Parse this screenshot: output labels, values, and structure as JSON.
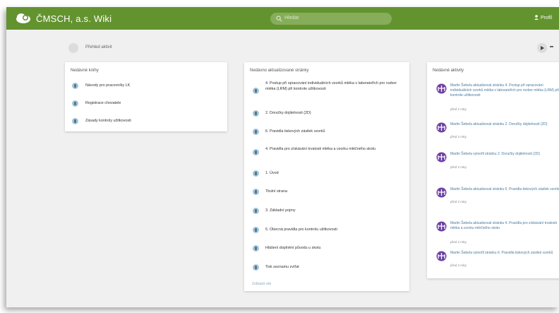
{
  "app": {
    "title": "ČMSCH, a.s. Wiki",
    "logo_icon": "cloud-logo-icon"
  },
  "search": {
    "placeholder": "Hledat",
    "icon": "search-icon"
  },
  "user": {
    "label": "Profil",
    "icon": "user-icon"
  },
  "breadcrumb": {
    "label": "Přehled aktivit",
    "icon": "home-icon"
  },
  "colors": {
    "topbar": "#63932f",
    "accent_link": "#4a7ba0",
    "activity_icon": "#6e3fa5"
  },
  "recent_books": {
    "title": "Nedávné knihy",
    "items": [
      {
        "label": "Návody pro pracovníky LK"
      },
      {
        "label": "Registrace chovatele"
      },
      {
        "label": "Zásady kontroly užitkovosti"
      }
    ]
  },
  "recent_pages": {
    "title": "Nedávno aktualizované stránky",
    "items": [
      {
        "label": "4. Postup při opracování individuálních vzorků mléka v laboratořích pro rozbor mléka (LRM) při kontrole užitkovosti"
      },
      {
        "label": "2. Doručky dojitelnosti (2D)"
      },
      {
        "label": "6. Pravidla tiskových zásilek vzorků"
      },
      {
        "label": "4. Pravidla pro získávání trvalosti mléka a vzorku mléčného skotu"
      },
      {
        "label": "1. Úvod"
      },
      {
        "label": "Titulní strana"
      },
      {
        "label": "3. Základní pojmy"
      },
      {
        "label": "5. Obecná pravidla pro kontrolu užitkovosti"
      },
      {
        "label": "Hlášení doplnění původu u skotu"
      },
      {
        "label": "Tisk seznamu zvířat"
      }
    ],
    "more_link": "Zobrazit vše"
  },
  "recent_activity": {
    "title": "Nedávné aktivity",
    "items": [
      {
        "text": "Martin Šebela aktualizoval stránku 4. Postup při opracování individuálních vzorků mléka v laboratořích pro rozbor mléka (LRM) při kontrole užitkovosti",
        "time": "před 2 roky"
      },
      {
        "text": "Martin Šebela aktualizoval stránku 2. Doručky dojitelnosti (2D)",
        "time": "před 2 roky"
      },
      {
        "text": "Martin Šebela vytvořil stránku 2. Doručky dojitelnosti (2D)",
        "time": "před 2 roky"
      },
      {
        "text": "Martin Šebela aktualizoval stránku 6. Pravidla tiskových zásilek vzorků",
        "time": "před 2 roky"
      },
      {
        "text": "Martin Šebela aktualizoval stránku 4. Pravidla pro získávání trvalosti mléka a vzorku mléčného skotu",
        "time": "před 2 roky"
      },
      {
        "text": "Martin Šebela vytvořil stránku 6. Pravidla tiskových zásilek vzorků",
        "time": "před 2 roky"
      }
    ]
  }
}
